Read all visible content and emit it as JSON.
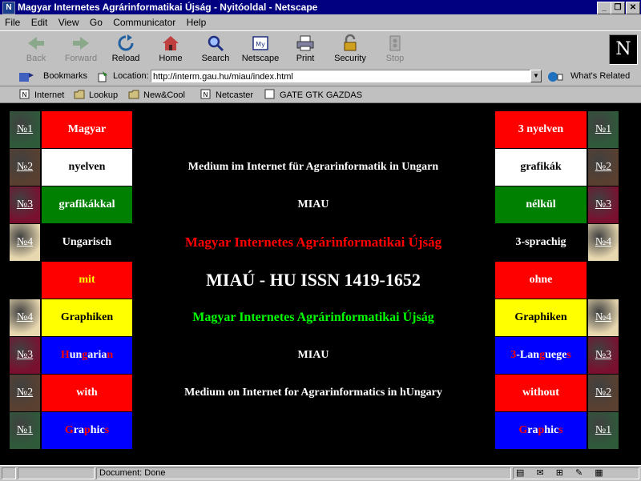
{
  "window": {
    "title": "Magyar Internetes Agrárinformatikai Újság - Nyitóoldal - Netscape",
    "app_icon": "netscape-icon"
  },
  "menu": [
    "File",
    "Edit",
    "View",
    "Go",
    "Communicator",
    "Help"
  ],
  "toolbar": {
    "back": "Back",
    "forward": "Forward",
    "reload": "Reload",
    "home": "Home",
    "search": "Search",
    "netscape": "Netscape",
    "print": "Print",
    "security": "Security",
    "stop": "Stop"
  },
  "location": {
    "bookmarks": "Bookmarks",
    "label": "Location:",
    "url": "http://interm.gau.hu/miau/index.html",
    "whats_related": "What's Related"
  },
  "personal": [
    "Internet",
    "Lookup",
    "New&Cool",
    "Netcaster",
    "GATE GTK GAZDAS"
  ],
  "page": {
    "left_nums": [
      "№1",
      "№2",
      "№3",
      "№4",
      "",
      "№4",
      "№3",
      "№2",
      "№1"
    ],
    "right_nums": [
      "№1",
      "№2",
      "№3",
      "№4",
      "",
      "№4",
      "№3",
      "№2",
      "№1"
    ],
    "left_cells": [
      "Magyar",
      "nyelven",
      "grafikákkal",
      "Ungarisch",
      "mit",
      "Graphiken",
      "Hungarian",
      "with",
      "Graphics"
    ],
    "right_cells": [
      "3 nyelven",
      "grafikák",
      "nélkül",
      "3-sprachig",
      "ohne",
      "Graphiken",
      "3-Languages",
      "without",
      "Graphics"
    ],
    "mid_rows": [
      "",
      "Medium im Internet für Agrarinformatik in Ungarn",
      "MIAU",
      "Magyar Internetes Agrárinformatikai Újság",
      "MIAÚ - HU ISSN 1419-1652",
      "Magyar Internetes Agrárinformatikai Újság",
      "MIAU",
      "Medium on Internet for Agrarinformatics in hUngary",
      ""
    ],
    "hungarian_parts": [
      "H",
      " un ",
      "g",
      " aria ",
      "n"
    ],
    "graphics_parts": [
      "G",
      " ra ",
      "p",
      " hic ",
      "s"
    ],
    "languages_parts": [
      "3",
      " -Lan ",
      "g",
      " uege ",
      "s"
    ],
    "colors": {
      "red": "#ff0000",
      "white": "#ffffff",
      "green": "#008000",
      "yellow": "#ffff00",
      "blue": "#0000ff",
      "bright_green": "#00ff00"
    }
  },
  "status": {
    "text": "Document: Done"
  }
}
